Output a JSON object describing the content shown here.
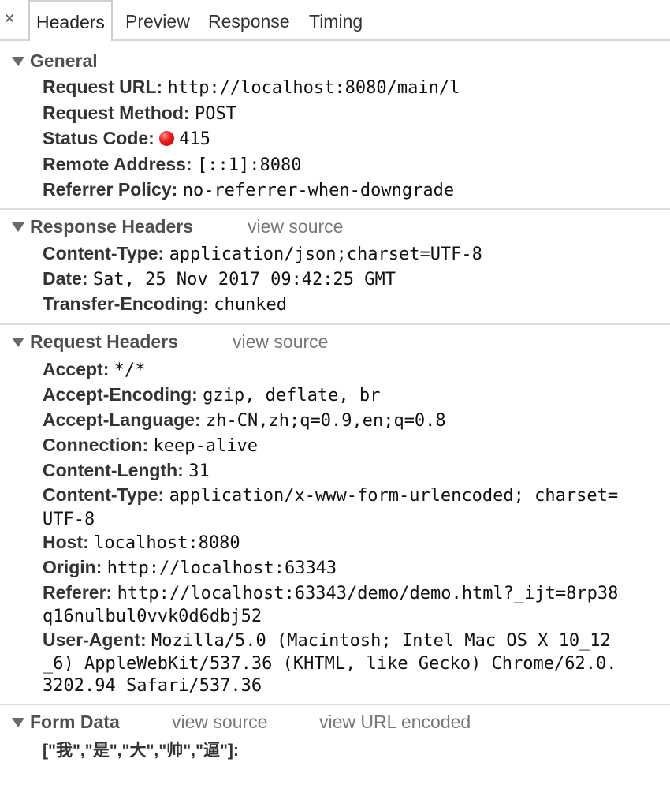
{
  "tabbar": {
    "close_glyph": "×",
    "tabs": [
      "Headers",
      "Preview",
      "Response",
      "Timing"
    ]
  },
  "general": {
    "title": "General",
    "rows": [
      {
        "key": "Request URL:",
        "value": "http://localhost:8080/main/l"
      },
      {
        "key": "Request Method:",
        "value": "POST"
      },
      {
        "key": "Status Code:",
        "value": "415",
        "status_color": "#e81a1a"
      },
      {
        "key": "Remote Address:",
        "value": "[::1]:8080"
      },
      {
        "key": "Referrer Policy:",
        "value": "no-referrer-when-downgrade"
      }
    ]
  },
  "response_headers": {
    "title": "Response Headers",
    "view_source": "view source",
    "rows": [
      {
        "key": "Content-Type:",
        "value": "application/json;charset=UTF-8"
      },
      {
        "key": "Date:",
        "value": "Sat, 25 Nov 2017 09:42:25 GMT"
      },
      {
        "key": "Transfer-Encoding:",
        "value": "chunked"
      }
    ]
  },
  "request_headers": {
    "title": "Request Headers",
    "view_source": "view source",
    "rows": [
      {
        "key": "Accept:",
        "value": "*/*"
      },
      {
        "key": "Accept-Encoding:",
        "value": "gzip, deflate, br"
      },
      {
        "key": "Accept-Language:",
        "value": "zh-CN,zh;q=0.9,en;q=0.8"
      },
      {
        "key": "Connection:",
        "value": "keep-alive"
      },
      {
        "key": "Content-Length:",
        "value": "31"
      },
      {
        "key": "Content-Type:",
        "value": "application/x-www-form-urlencoded; charset=",
        "cont": "UTF-8"
      },
      {
        "key": "Host:",
        "value": "localhost:8080"
      },
      {
        "key": "Origin:",
        "value": "http://localhost:63343"
      },
      {
        "key": "Referer:",
        "value": "http://localhost:63343/demo/demo.html?_ijt=8rp38",
        "cont": "q16nulbul0vvk0d6dbj52"
      },
      {
        "key": "User-Agent:",
        "value": "Mozilla/5.0 (Macintosh; Intel Mac OS X 10_12",
        "cont": "_6) AppleWebKit/537.36 (KHTML, like Gecko) Chrome/62.0.",
        "cont2": "3202.94 Safari/537.36"
      }
    ]
  },
  "form_data": {
    "title": "Form Data",
    "view_source": "view source",
    "view_url_encoded": "view URL encoded",
    "entry": "[\"我\",\"是\",\"大\",\"帅\",\"逼\"]:"
  },
  "colors": {
    "section_title": "#4f4f4f",
    "link_gray": "#777777",
    "status_red": "#e81a1a"
  }
}
